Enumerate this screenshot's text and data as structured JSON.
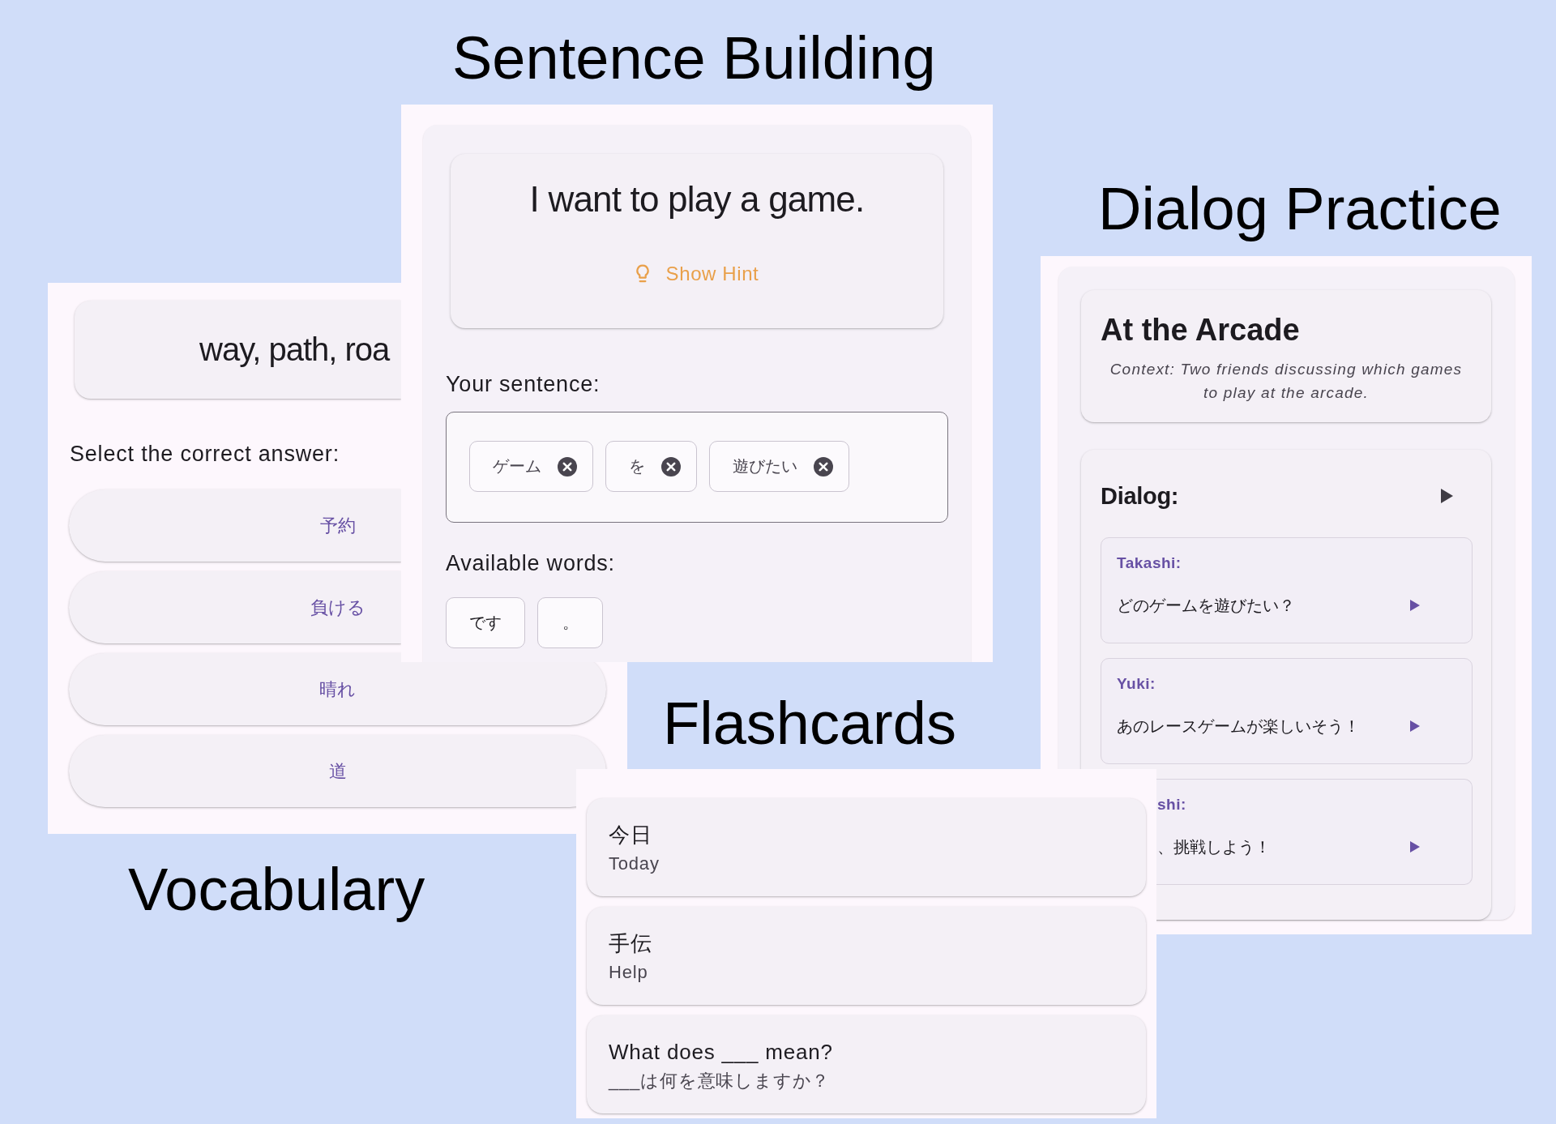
{
  "sentence_building": {
    "heading": "Sentence Building",
    "prompt": "I want to play a game.",
    "hint_button": "Show Hint",
    "sentence_label": "Your sentence:",
    "sentence_words": [
      "ゲーム",
      "を",
      "遊びたい"
    ],
    "available_label": "Available words:",
    "available_words": [
      "です",
      "。"
    ]
  },
  "vocabulary": {
    "heading": "Vocabulary",
    "prompt": "way, path, roa",
    "instruction": "Select the correct answer:",
    "options": [
      {
        "label": "予約",
        "selected": false,
        "covered": true
      },
      {
        "label": "負ける",
        "selected": false,
        "covered": true
      },
      {
        "label": "晴れ",
        "selected": false,
        "covered": false
      },
      {
        "label": "道",
        "selected": false,
        "covered": false
      }
    ]
  },
  "dialog_practice": {
    "heading": "Dialog Practice",
    "title": "At the Arcade",
    "context": "Context: Two friends discussing which games to play at the arcade.",
    "dialog_label": "Dialog:",
    "lines": [
      {
        "speaker": "Takashi:",
        "text": "どのゲームを遊びたい？",
        "covered": false
      },
      {
        "speaker": "Yuki:",
        "text": "あのレースゲームが楽しいそう！",
        "covered": false
      },
      {
        "speaker": "shi:",
        "text": "、挑戦しよう！",
        "covered": true
      }
    ]
  },
  "flashcards": {
    "heading": "Flashcards",
    "cards": [
      {
        "front": "今日",
        "back": "Today"
      },
      {
        "front": "手伝",
        "back": "Help"
      },
      {
        "front": "What does ___ mean?",
        "back": "___は何を意味しますか？"
      }
    ]
  }
}
